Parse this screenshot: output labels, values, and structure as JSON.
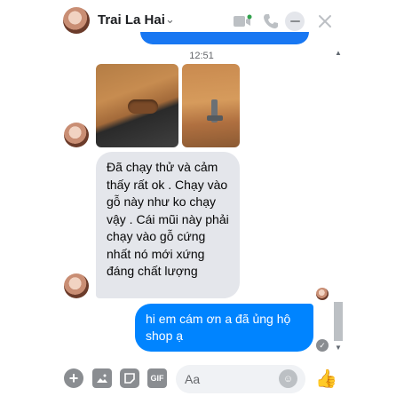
{
  "header": {
    "name": "Trai La Hai",
    "chevron": "⌄",
    "icons": [
      "video-call-icon",
      "phone-icon",
      "minimize-icon",
      "close-icon"
    ]
  },
  "messages": {
    "timestamp": "12:51",
    "incoming_text": "Đã chạy thử và cảm thấy rất ok . Chạy vào gỗ này như ko chạy vậy . Cái mũi này phải chạy vào gỗ cứng nhất nó mới xứng đáng chất lượng",
    "outgoing_text": "hi em cám ơn a đã ủng hộ shop ạ"
  },
  "composer": {
    "placeholder": "Aa",
    "gif_label": "GIF"
  },
  "colors": {
    "accent": "#0084ff",
    "incoming_bubble": "#e4e6eb",
    "icon_gray": "#8a8d91"
  }
}
